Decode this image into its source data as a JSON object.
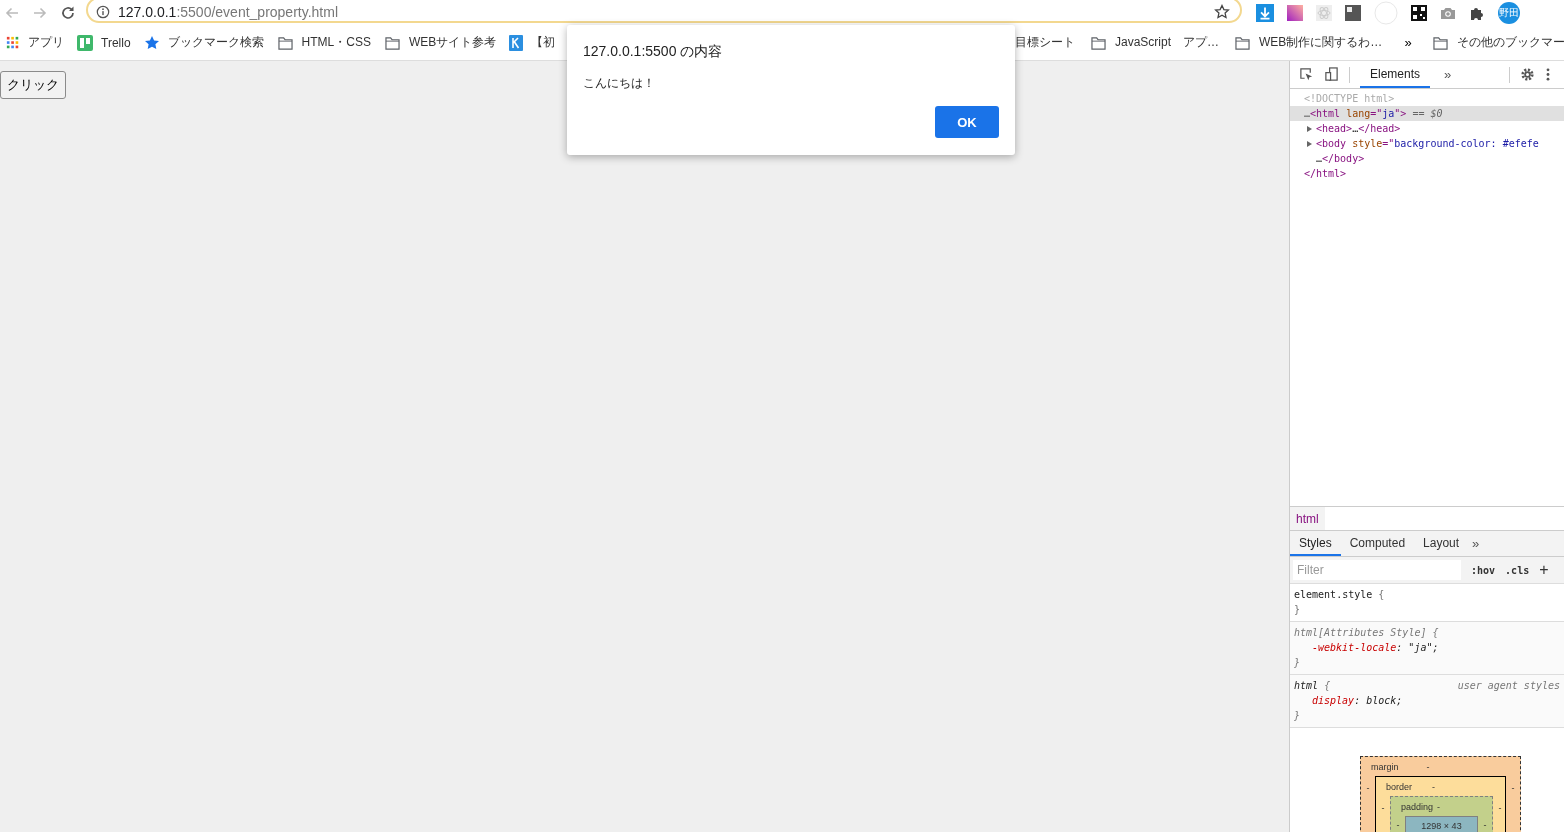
{
  "toolbar": {
    "url_host": "127.0.0.1",
    "url_path": ":5500/event_property.html",
    "avatar": "野田"
  },
  "bookmarks_left": [
    {
      "label": "アプリ",
      "kind": "apps"
    },
    {
      "label": "Trello",
      "kind": "trello"
    },
    {
      "label": "ブックマーク検索",
      "kind": "star"
    },
    {
      "label": "HTML・CSS",
      "kind": "folder"
    },
    {
      "label": "WEBサイト参考",
      "kind": "folder"
    },
    {
      "label": "【初",
      "kind": "k"
    }
  ],
  "bookmarks_right": [
    {
      "label": "目標シート",
      "kind": "none"
    },
    {
      "label": "JavaScript　アプ…",
      "kind": "folder"
    },
    {
      "label": "WEB制作に関するわ…",
      "kind": "folder"
    }
  ],
  "bookmarks_more": "»",
  "other_bookmarks": {
    "label": "その他のブックマー",
    "kind": "folder"
  },
  "page": {
    "button": "クリック"
  },
  "dialog": {
    "title": "127.0.0.1:5500 の内容",
    "message": "こんにちは！",
    "ok": "OK"
  },
  "devtools": {
    "tabs": [
      {
        "label": "Elements",
        "selected": true
      }
    ],
    "more": "»",
    "dom": [
      {
        "tokens": [
          {
            "t": "<!DOCTYPE html>",
            "kind": "doctype"
          }
        ],
        "expandable": false,
        "selected": false
      },
      {
        "tokens": [
          {
            "t": "…",
            "kind": "handle"
          },
          {
            "t": "<html",
            "kind": "tag"
          },
          {
            "t": " lang",
            "kind": "attr"
          },
          {
            "t": "=\"",
            "kind": "tag"
          },
          {
            "t": "ja",
            "kind": "val"
          },
          {
            "t": "\">",
            "kind": "tag"
          },
          {
            "t": " == $0",
            "kind": "ref"
          }
        ],
        "expandable": false,
        "selected": true,
        "children": [
          {
            "tokens": [
              {
                "t": "<head>",
                "kind": "tag"
              },
              {
                "t": "…",
                "kind": "text"
              },
              {
                "t": "</head>",
                "kind": "tag"
              }
            ],
            "expandable": true,
            "selected": false
          },
          {
            "tokens": [
              {
                "t": "<body",
                "kind": "tag"
              },
              {
                "t": " style",
                "kind": "attr"
              },
              {
                "t": "=\"",
                "kind": "tag"
              },
              {
                "t": "background-color: #efefe",
                "kind": "val"
              }
            ],
            "expandable": true,
            "selected": false,
            "close": [
              {
                "t": "…",
                "kind": "text"
              },
              {
                "t": "</body>",
                "kind": "tag"
              }
            ]
          }
        ],
        "close": [
          {
            "t": "</html>",
            "kind": "tag"
          }
        ]
      }
    ],
    "breadcrumb": "html",
    "style_tabs": [
      {
        "label": "Styles",
        "selected": true
      },
      {
        "label": "Computed",
        "selected": false
      },
      {
        "label": "Layout",
        "selected": false
      }
    ],
    "style_more": "»",
    "filter": {
      "placeholder": "Filter"
    },
    "hov": ":hov",
    "cls": ".cls",
    "add": "+",
    "rules": [
      {
        "kind": "inline",
        "selector": "element.style",
        "open": "{",
        "close": "}"
      },
      {
        "kind": "attributes",
        "selector": "html[Attributes Style]",
        "open": "{",
        "close": "}",
        "props": [
          {
            "name": "-webkit-locale",
            "value": ": \"ja\";"
          }
        ]
      },
      {
        "kind": "user_agent",
        "selector": "html",
        "open": "{",
        "source": "user agent styles",
        "close": "}",
        "props": [
          {
            "name": "display",
            "value": ": block;"
          }
        ]
      }
    ],
    "box_model": {
      "margin_label": "margin",
      "margin": "-",
      "margin_left": "-",
      "margin_right": "-",
      "border_label": "border",
      "border": "-",
      "border_left": "-",
      "border_right": "-",
      "padding_label": "padding",
      "padding": "-",
      "padding_left": "-",
      "padding_right": "-",
      "content": "1298 × 43"
    }
  }
}
